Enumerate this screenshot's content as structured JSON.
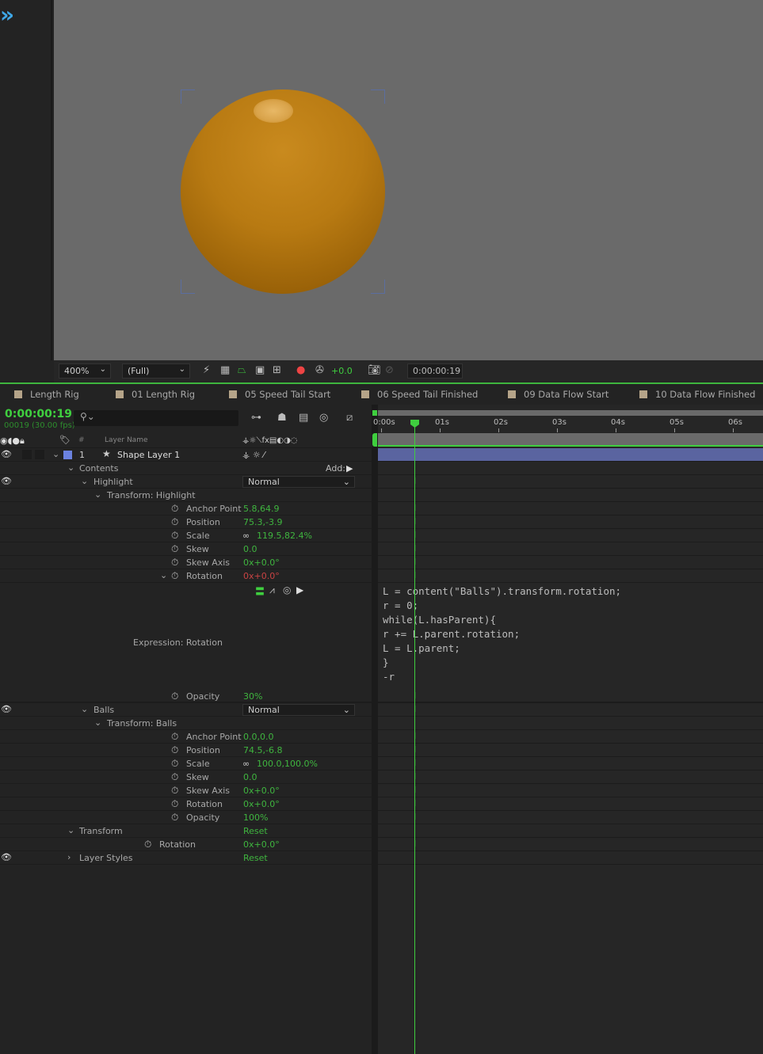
{
  "viewer": {
    "zoom": "400%",
    "resolution": "(Full)",
    "exposure": "+0.0",
    "timecode": "0:00:00:19"
  },
  "tabs": [
    "Length Rig",
    "01 Length Rig",
    "05 Speed Tail Start",
    "06 Speed Tail Finished",
    "09 Data Flow Start",
    "10 Data Flow Finished"
  ],
  "timeline": {
    "current_time": "0:00:00:19",
    "frame_info": "00019 (30.00 fps)",
    "search_placeholder": "",
    "col_num": "#",
    "col_layer_name": "Layer Name",
    "ruler": [
      "0:00s",
      "01s",
      "02s",
      "03s",
      "04s",
      "05s",
      "06s"
    ],
    "layer": {
      "num": "1",
      "name": "Shape Layer 1",
      "label_color": "#6b82e0"
    },
    "add_label": "Add:",
    "expression_label": "Expression: Rotation",
    "expression_code": "L = content(\"Balls\").transform.rotation;\nr = 0;\nwhile(L.hasParent){\nr += L.parent.rotation;\nL = L.parent;\n}\n-r",
    "rows": [
      {
        "label": "Contents",
        "indent": 1,
        "twirl": "open"
      },
      {
        "label": "Highlight",
        "indent": 2,
        "twirl": "open",
        "eye": true,
        "blend": "Normal"
      },
      {
        "label": "Transform: Highlight",
        "indent": 3,
        "twirl": "open"
      },
      {
        "label": "Anchor Point",
        "indent": 4,
        "sw": true,
        "value": "5.8,64.9"
      },
      {
        "label": "Position",
        "indent": 4,
        "sw": true,
        "value": "75.3,-3.9"
      },
      {
        "label": "Scale",
        "indent": 4,
        "sw": true,
        "link": true,
        "value": "119.5,82.4%"
      },
      {
        "label": "Skew",
        "indent": 4,
        "sw": true,
        "value": "0.0"
      },
      {
        "label": "Skew Axis",
        "indent": 4,
        "sw": true,
        "value": "0x+0.0°"
      },
      {
        "label": "Rotation",
        "indent": 4,
        "sw": true,
        "value": "0x+0.0°",
        "expr": true
      },
      {
        "label": "Opacity",
        "indent": 4,
        "sw": true,
        "value": "30%"
      },
      {
        "label": "Balls",
        "indent": 2,
        "twirl": "open",
        "eye": true,
        "blend": "Normal"
      },
      {
        "label": "Transform: Balls",
        "indent": 3,
        "twirl": "open"
      },
      {
        "label": "Anchor Point",
        "indent": 4,
        "sw": true,
        "value": "0.0,0.0"
      },
      {
        "label": "Position",
        "indent": 4,
        "sw": true,
        "value": "74.5,-6.8"
      },
      {
        "label": "Scale",
        "indent": 4,
        "sw": true,
        "link": true,
        "value": "100.0,100.0%"
      },
      {
        "label": "Skew",
        "indent": 4,
        "sw": true,
        "value": "0.0"
      },
      {
        "label": "Skew Axis",
        "indent": 4,
        "sw": true,
        "value": "0x+0.0°"
      },
      {
        "label": "Rotation",
        "indent": 4,
        "sw": true,
        "value": "0x+0.0°"
      },
      {
        "label": "Opacity",
        "indent": 4,
        "sw": true,
        "value": "100%"
      },
      {
        "label": "Transform",
        "indent": 1,
        "twirl": "open",
        "value": "Reset"
      },
      {
        "label": "Rotation",
        "indent": 2,
        "sw": true,
        "value": "0x+0.0°"
      },
      {
        "label": "Layer Styles",
        "indent": 1,
        "twirl": "closed",
        "eye": true,
        "value": "Reset"
      }
    ]
  },
  "colors": {
    "accent": "#3fcf3f",
    "layer_bar": "#5a64a0",
    "expression_value": "#c84343"
  }
}
